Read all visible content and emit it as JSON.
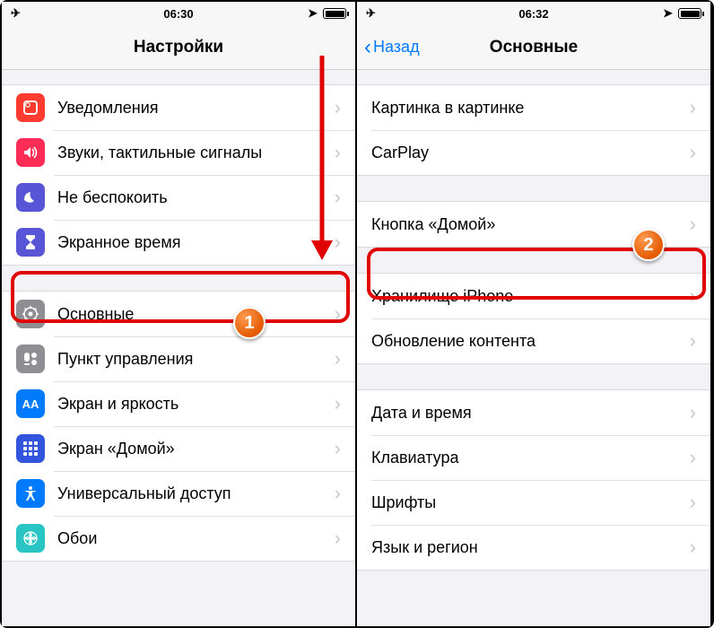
{
  "left": {
    "status": {
      "time": "06:30"
    },
    "nav": {
      "title": "Настройки"
    },
    "group1": [
      {
        "id": "notifications",
        "label": "Уведомления",
        "bg": "#ff3b30"
      },
      {
        "id": "sounds",
        "label": "Звуки, тактильные сигналы",
        "bg": "#ff2d55"
      },
      {
        "id": "dnd",
        "label": "Не беспокоить",
        "bg": "#5856d6"
      },
      {
        "id": "screentime",
        "label": "Экранное время",
        "bg": "#5856d6"
      }
    ],
    "group2": [
      {
        "id": "general",
        "label": "Основные",
        "bg": "#8e8e93"
      },
      {
        "id": "controlcenter",
        "label": "Пункт управления",
        "bg": "#8e8e93"
      },
      {
        "id": "display",
        "label": "Экран и яркость",
        "bg": "#007aff",
        "text": "AA"
      },
      {
        "id": "homescreen",
        "label": "Экран «Домой»",
        "bg": "#3355dd"
      },
      {
        "id": "accessibility",
        "label": "Универсальный доступ",
        "bg": "#007aff"
      },
      {
        "id": "wallpaper",
        "label": "Обои",
        "bg": "#29c5c5"
      }
    ]
  },
  "right": {
    "status": {
      "time": "06:32"
    },
    "nav": {
      "title": "Основные",
      "back": "Назад"
    },
    "group1": [
      {
        "id": "pip",
        "label": "Картинка в картинке"
      },
      {
        "id": "carplay",
        "label": "CarPlay"
      }
    ],
    "group2": [
      {
        "id": "homebutton",
        "label": "Кнопка «Домой»"
      }
    ],
    "group3": [
      {
        "id": "storage",
        "label": "Хранилище iPhone"
      },
      {
        "id": "bgrefresh",
        "label": "Обновление контента"
      }
    ],
    "group4": [
      {
        "id": "datetime",
        "label": "Дата и время"
      },
      {
        "id": "keyboard",
        "label": "Клавиатура"
      },
      {
        "id": "fonts",
        "label": "Шрифты"
      },
      {
        "id": "language",
        "label": "Язык и регион"
      }
    ]
  },
  "markers": {
    "one": "1",
    "two": "2"
  }
}
